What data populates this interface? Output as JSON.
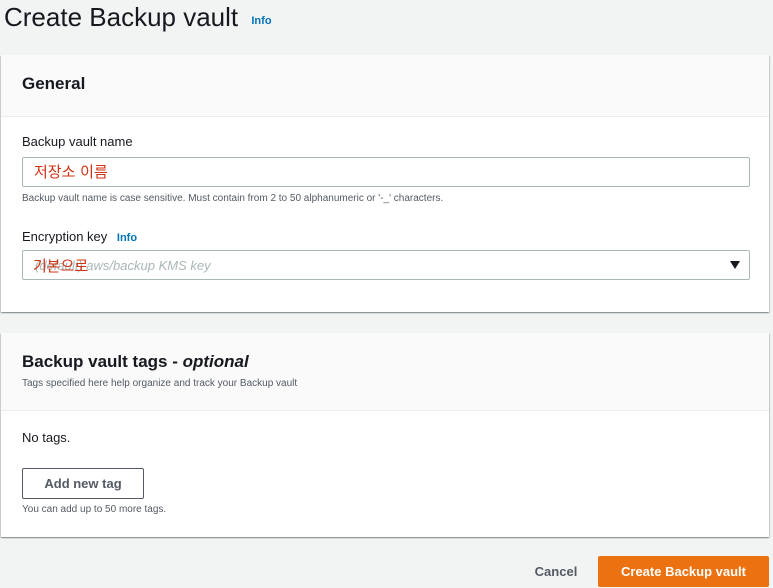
{
  "page": {
    "title": "Create Backup vault",
    "info_label": "Info"
  },
  "general": {
    "title": "General",
    "vault_name_label": "Backup vault name",
    "vault_name_value": "저장소 이름",
    "vault_name_constraint": "Backup vault name is case sensitive. Must contain from 2 to 50 alphanumeric or '-_' characters.",
    "encryption_label": "Encryption key",
    "encryption_info": "Info",
    "encryption_placeholder": "(default) aws/backup KMS key",
    "encryption_overlay": "기본으로"
  },
  "tags": {
    "title": "Backup vault tags",
    "title_optional": "optional",
    "description": "Tags specified here help organize and track your Backup vault",
    "empty_text": "No tags.",
    "add_button": "Add new tag",
    "limit_hint": "You can add up to 50 more tags."
  },
  "footer": {
    "cancel": "Cancel",
    "submit": "Create Backup vault"
  },
  "colors": {
    "accent": "#ec7211",
    "link": "#0073bb",
    "annotation": "#d13212"
  },
  "icons": {
    "encryption_dropdown": "caret-down-icon"
  }
}
